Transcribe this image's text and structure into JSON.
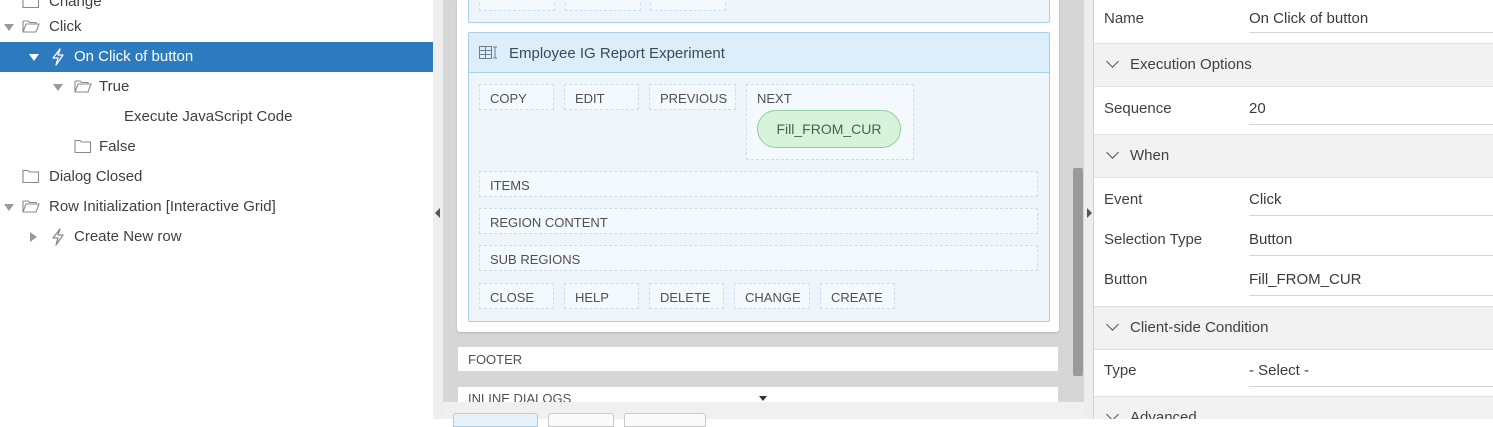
{
  "tree": {
    "nodes": [
      {
        "label": "Change",
        "icon": "folder-icon",
        "twisty": "none"
      },
      {
        "label": "Click",
        "icon": "folder-open-icon",
        "twisty": "down"
      },
      {
        "label": "On Click of button",
        "icon": "lightning-icon",
        "twisty": "down",
        "selected": true
      },
      {
        "label": "True",
        "icon": "folder-open-icon",
        "twisty": "down"
      },
      {
        "label": "Execute JavaScript Code",
        "icon": "",
        "twisty": "none"
      },
      {
        "label": "False",
        "icon": "folder-icon",
        "twisty": "none"
      },
      {
        "label": "Dialog Closed",
        "icon": "folder-icon",
        "twisty": "none"
      },
      {
        "label": "Row Initialization [Interactive Grid]",
        "icon": "folder-open-icon",
        "twisty": "down"
      },
      {
        "label": "Create New row",
        "icon": "lightning-icon",
        "twisty": "right"
      }
    ]
  },
  "layout_editor": {
    "region_title": "Employee IG Report Experiment",
    "region_icon": "interactive-grid-icon",
    "slots": {
      "copy": "COPY",
      "edit": "EDIT",
      "previous": "PREVIOUS",
      "next": "NEXT",
      "items": "ITEMS",
      "region_content": "REGION CONTENT",
      "sub_regions": "SUB REGIONS",
      "close": "CLOSE",
      "help": "HELP",
      "delete": "DELETE",
      "change": "CHANGE",
      "create": "CREATE"
    },
    "button_component": "Fill_FROM_CUR",
    "footer": "FOOTER",
    "inline_dialogs": "INLINE DIALOGS"
  },
  "properties": {
    "name_label": "Name",
    "name_value": "On Click of button",
    "sections": {
      "execution": "Execution Options",
      "when": "When",
      "client_condition": "Client-side Condition",
      "advanced": "Advanced"
    },
    "sequence_label": "Sequence",
    "sequence_value": "20",
    "event_label": "Event",
    "event_value": "Click",
    "selection_type_label": "Selection Type",
    "selection_type_value": "Button",
    "button_label": "Button",
    "button_value": "Fill_FROM_CUR",
    "type_label": "Type",
    "type_value": "- Select -"
  },
  "colors": {
    "selection": "#2d7bbe",
    "region_header": "#dceefa",
    "button_pill": "#d9f2dc"
  }
}
